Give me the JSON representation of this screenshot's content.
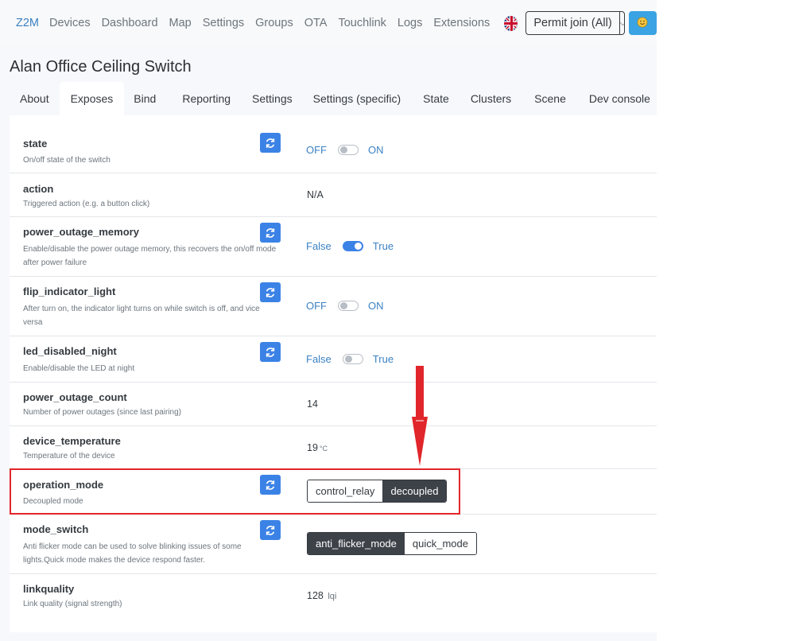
{
  "navbar": {
    "brand": "Z2M",
    "links": [
      "Devices",
      "Dashboard",
      "Map",
      "Settings",
      "Groups",
      "OTA",
      "Touchlink",
      "Logs",
      "Extensions"
    ],
    "permit_join_label": "Permit join (All)",
    "language_icon": "uk-flag-icon",
    "theme_icon": "smiley-icon"
  },
  "page": {
    "title": "Alan Office Ceiling Switch",
    "tabs": [
      "About",
      "Exposes",
      "Bind",
      "Reporting",
      "Settings",
      "Settings (specific)",
      "State",
      "Clusters",
      "Scene",
      "Dev console"
    ],
    "active_tab": "Exposes"
  },
  "exposes": [
    {
      "name": "state",
      "description": "On/off state of the switch",
      "off_label": "OFF",
      "on_label": "ON",
      "value": false
    },
    {
      "name": "action",
      "description": "Triggered action (e.g. a button click)",
      "value": "N/A"
    },
    {
      "name": "power_outage_memory",
      "description": "Enable/disable the power outage memory, this recovers the on/off mode after power failure",
      "off_label": "False",
      "on_label": "True",
      "value": true
    },
    {
      "name": "flip_indicator_light",
      "description": "After turn on, the indicator light turns on while switch is off, and vice versa",
      "off_label": "OFF",
      "on_label": "ON",
      "value": false
    },
    {
      "name": "led_disabled_night",
      "description": "Enable/disable the LED at night",
      "off_label": "False",
      "on_label": "True",
      "value": false
    },
    {
      "name": "power_outage_count",
      "description": "Number of power outages (since last pairing)",
      "value": "14"
    },
    {
      "name": "device_temperature",
      "description": "Temperature of the device",
      "value": "19",
      "unit": "°C"
    },
    {
      "name": "operation_mode",
      "description": "Decoupled mode",
      "options": [
        "control_relay",
        "decoupled"
      ],
      "selected": "decoupled"
    },
    {
      "name": "mode_switch",
      "description": "Anti flicker mode can be used to solve blinking issues of some lights.Quick mode makes the device respond faster.",
      "options": [
        "anti_flicker_mode",
        "quick_mode"
      ],
      "selected": "anti_flicker_mode"
    },
    {
      "name": "linkquality",
      "description": "Link quality (signal strength)",
      "value": "128",
      "unit": "lqi"
    }
  ],
  "colors": {
    "accent": "#3b82e6",
    "brand": "#3b82c4",
    "highlight": "#e1262b",
    "selected_segment": "#3d4148"
  }
}
